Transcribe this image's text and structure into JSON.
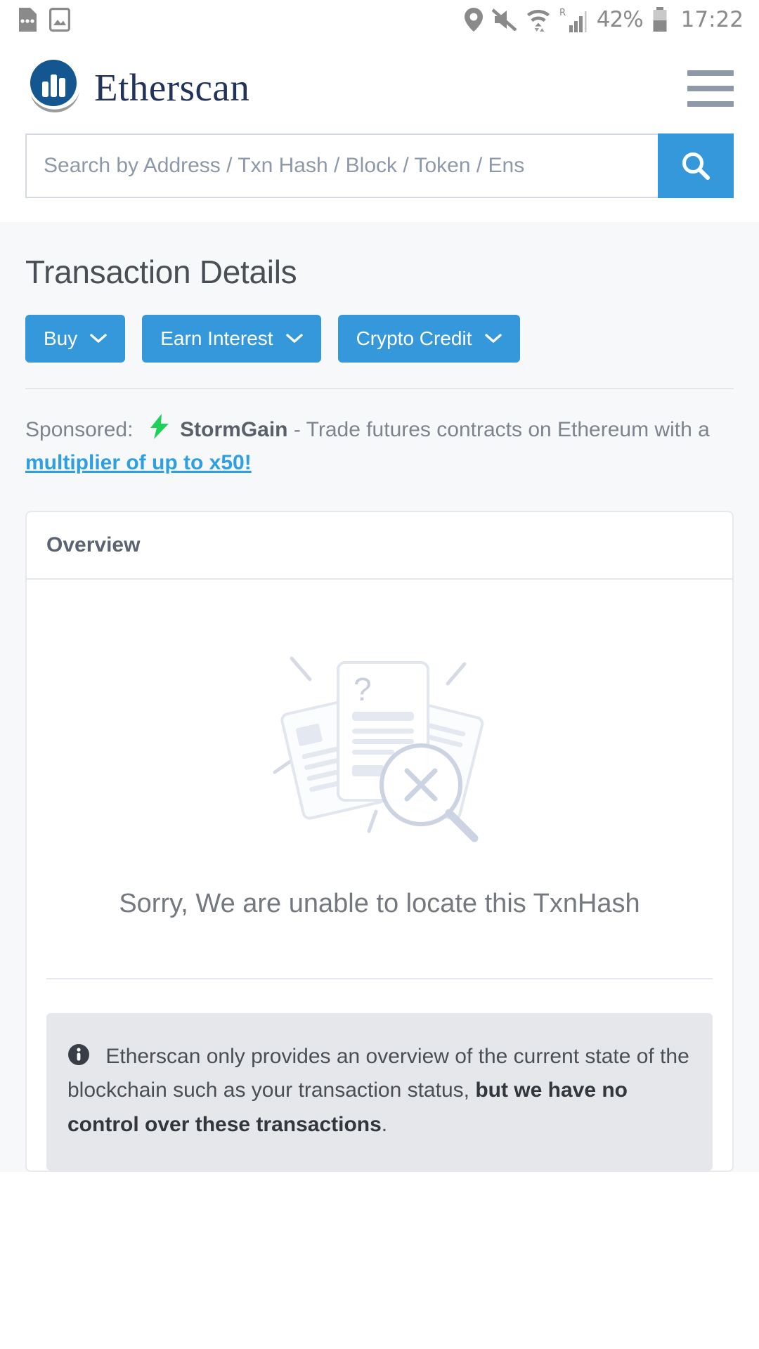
{
  "statusbar": {
    "battery": "42%",
    "clock": "17:22",
    "roaming_label": "R",
    "icons": [
      "sim-card-icon",
      "gallery-icon",
      "location-icon",
      "mute-icon",
      "wifi-icon",
      "signal-icon",
      "battery-icon"
    ]
  },
  "header": {
    "brand": "Etherscan",
    "menu_icon": "hamburger-menu-icon"
  },
  "search": {
    "placeholder": "Search by Address / Txn Hash / Block / Token / Ens",
    "value": "",
    "button_icon": "search-icon",
    "button_color": "#3498db"
  },
  "main": {
    "title": "Transaction Details",
    "buttons": [
      {
        "label": "Buy",
        "icon": "chevron-down-icon"
      },
      {
        "label": "Earn Interest",
        "icon": "chevron-down-icon"
      },
      {
        "label": "Crypto Credit",
        "icon": "chevron-down-icon"
      }
    ],
    "sponsored": {
      "prefix": "Sponsored:",
      "icon": "lightning-bolt-icon",
      "advertiser": "StormGain",
      "text_before_link": "- Trade futures contracts on Ethereum with a",
      "link": "multiplier of up to x50!"
    },
    "card": {
      "heading": "Overview",
      "illustration": "documents-magnifier-not-found-icon",
      "empty_message": "Sorry, We are unable to locate this TxnHash",
      "info": {
        "icon": "info-circle-icon",
        "text": "Etherscan only provides an overview of the current state of the blockchain such as your transaction status,",
        "bold_text": "but we have no control over these transactions",
        "suffix": "."
      }
    }
  },
  "colors": {
    "accent": "#3498db",
    "brand_dark": "#21325b",
    "page_bg": "#f7f8fa",
    "muted_text": "#7d848d"
  }
}
